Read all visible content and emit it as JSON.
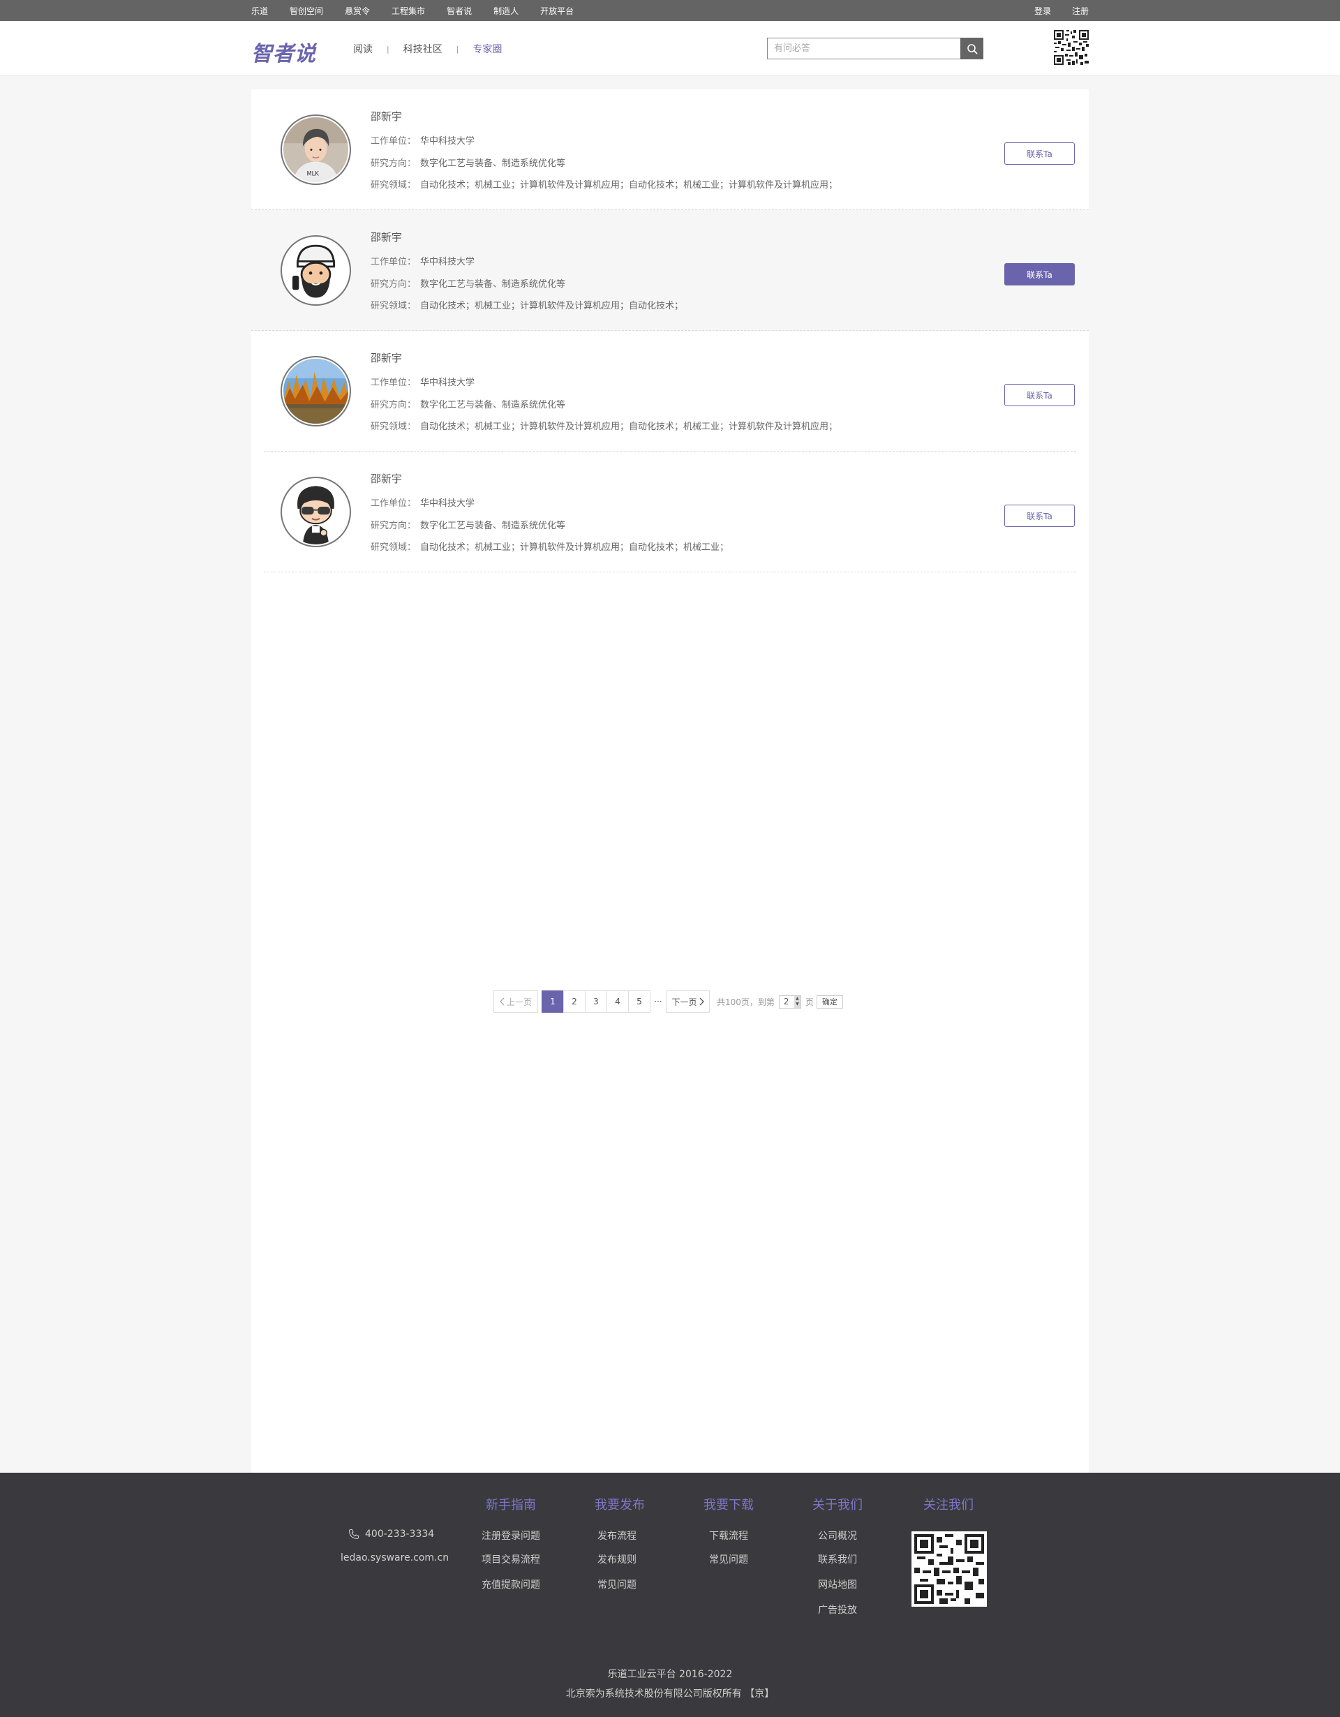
{
  "topbar": {
    "links": [
      "乐道",
      "智创空间",
      "悬赏令",
      "工程集市",
      "智者说",
      "制造人",
      "开放平台"
    ],
    "login": "登录",
    "register": "注册"
  },
  "header": {
    "logo": "智者说",
    "nav": [
      "阅读",
      "科技社区",
      "专家圈"
    ],
    "nav_separator": "|",
    "active_nav": "专家圈",
    "search_placeholder": "有问必答"
  },
  "labels": {
    "unit": "工作单位：",
    "direction": "研究方向：",
    "field": "研究领域：",
    "contact": "联系Ta"
  },
  "experts": [
    {
      "name": "邵新宇",
      "unit": "华中科技大学",
      "direction": "数字化工艺与装备、制造系统优化等",
      "field": "自动化技术；机械工业；计算机软件及计算机应用；自动化技术；机械工业；计算机软件及计算机应用；",
      "avatar": "photo-young-man"
    },
    {
      "name": "邵新宇",
      "unit": "华中科技大学",
      "direction": "数字化工艺与装备、制造系统优化等",
      "field": "自动化技术；机械工业；计算机软件及计算机应用；自动化技术；",
      "avatar": "cartoon-bearded-man"
    },
    {
      "name": "邵新宇",
      "unit": "华中科技大学",
      "direction": "数字化工艺与装备、制造系统优化等",
      "field": "自动化技术；机械工业；计算机软件及计算机应用；自动化技术；机械工业；计算机软件及计算机应用；",
      "avatar": "autumn-forest-lake"
    },
    {
      "name": "邵新宇",
      "unit": "华中科技大学",
      "direction": "数字化工艺与装备、制造系统优化等",
      "field": "自动化技术；机械工业；计算机软件及计算机应用；自动化技术；机械工业；",
      "avatar": "cartoon-sunglasses-boy"
    }
  ],
  "pagination": {
    "prev": "上一页",
    "pages": [
      "1",
      "2",
      "3",
      "4",
      "5"
    ],
    "current": "1",
    "ellipsis": "···",
    "next": "下一页",
    "total": "共100页，到第",
    "jump_value": "2",
    "unit": "页",
    "confirm": "确定"
  },
  "footer": {
    "columns": [
      {
        "title": "新手指南",
        "links": [
          "注册登录问题",
          "项目交易流程",
          "充值提款问题"
        ]
      },
      {
        "title": "我要发布",
        "links": [
          "发布流程",
          "发布规则",
          "常见问题"
        ]
      },
      {
        "title": "我要下载",
        "links": [
          "下载流程",
          "常见问题"
        ]
      },
      {
        "title": "关于我们",
        "links": [
          "公司概况",
          "联系我们",
          "网站地图",
          "广告投放"
        ]
      },
      {
        "title": "关注我们",
        "links": []
      }
    ],
    "phone": "400-233-3334",
    "website": "ledao.sysware.com.cn",
    "copyright": "乐道工业云平台 2016-2022",
    "company": "北京索为系统技术股份有限公司版权所有 【京】"
  },
  "colors": {
    "accent": "#6a64ad",
    "topbar": "#646464",
    "footer": "#3a393d"
  }
}
